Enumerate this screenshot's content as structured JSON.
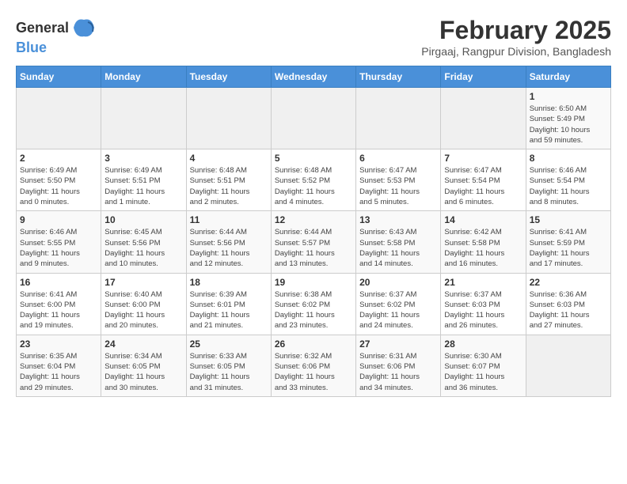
{
  "header": {
    "logo_general": "General",
    "logo_blue": "Blue",
    "title": "February 2025",
    "subtitle": "Pirgaaj, Rangpur Division, Bangladesh"
  },
  "weekdays": [
    "Sunday",
    "Monday",
    "Tuesday",
    "Wednesday",
    "Thursday",
    "Friday",
    "Saturday"
  ],
  "weeks": [
    [
      {
        "day": "",
        "info": ""
      },
      {
        "day": "",
        "info": ""
      },
      {
        "day": "",
        "info": ""
      },
      {
        "day": "",
        "info": ""
      },
      {
        "day": "",
        "info": ""
      },
      {
        "day": "",
        "info": ""
      },
      {
        "day": "1",
        "info": "Sunrise: 6:50 AM\nSunset: 5:49 PM\nDaylight: 10 hours\nand 59 minutes."
      }
    ],
    [
      {
        "day": "2",
        "info": "Sunrise: 6:49 AM\nSunset: 5:50 PM\nDaylight: 11 hours\nand 0 minutes."
      },
      {
        "day": "3",
        "info": "Sunrise: 6:49 AM\nSunset: 5:51 PM\nDaylight: 11 hours\nand 1 minute."
      },
      {
        "day": "4",
        "info": "Sunrise: 6:48 AM\nSunset: 5:51 PM\nDaylight: 11 hours\nand 2 minutes."
      },
      {
        "day": "5",
        "info": "Sunrise: 6:48 AM\nSunset: 5:52 PM\nDaylight: 11 hours\nand 4 minutes."
      },
      {
        "day": "6",
        "info": "Sunrise: 6:47 AM\nSunset: 5:53 PM\nDaylight: 11 hours\nand 5 minutes."
      },
      {
        "day": "7",
        "info": "Sunrise: 6:47 AM\nSunset: 5:54 PM\nDaylight: 11 hours\nand 6 minutes."
      },
      {
        "day": "8",
        "info": "Sunrise: 6:46 AM\nSunset: 5:54 PM\nDaylight: 11 hours\nand 8 minutes."
      }
    ],
    [
      {
        "day": "9",
        "info": "Sunrise: 6:46 AM\nSunset: 5:55 PM\nDaylight: 11 hours\nand 9 minutes."
      },
      {
        "day": "10",
        "info": "Sunrise: 6:45 AM\nSunset: 5:56 PM\nDaylight: 11 hours\nand 10 minutes."
      },
      {
        "day": "11",
        "info": "Sunrise: 6:44 AM\nSunset: 5:56 PM\nDaylight: 11 hours\nand 12 minutes."
      },
      {
        "day": "12",
        "info": "Sunrise: 6:44 AM\nSunset: 5:57 PM\nDaylight: 11 hours\nand 13 minutes."
      },
      {
        "day": "13",
        "info": "Sunrise: 6:43 AM\nSunset: 5:58 PM\nDaylight: 11 hours\nand 14 minutes."
      },
      {
        "day": "14",
        "info": "Sunrise: 6:42 AM\nSunset: 5:58 PM\nDaylight: 11 hours\nand 16 minutes."
      },
      {
        "day": "15",
        "info": "Sunrise: 6:41 AM\nSunset: 5:59 PM\nDaylight: 11 hours\nand 17 minutes."
      }
    ],
    [
      {
        "day": "16",
        "info": "Sunrise: 6:41 AM\nSunset: 6:00 PM\nDaylight: 11 hours\nand 19 minutes."
      },
      {
        "day": "17",
        "info": "Sunrise: 6:40 AM\nSunset: 6:00 PM\nDaylight: 11 hours\nand 20 minutes."
      },
      {
        "day": "18",
        "info": "Sunrise: 6:39 AM\nSunset: 6:01 PM\nDaylight: 11 hours\nand 21 minutes."
      },
      {
        "day": "19",
        "info": "Sunrise: 6:38 AM\nSunset: 6:02 PM\nDaylight: 11 hours\nand 23 minutes."
      },
      {
        "day": "20",
        "info": "Sunrise: 6:37 AM\nSunset: 6:02 PM\nDaylight: 11 hours\nand 24 minutes."
      },
      {
        "day": "21",
        "info": "Sunrise: 6:37 AM\nSunset: 6:03 PM\nDaylight: 11 hours\nand 26 minutes."
      },
      {
        "day": "22",
        "info": "Sunrise: 6:36 AM\nSunset: 6:03 PM\nDaylight: 11 hours\nand 27 minutes."
      }
    ],
    [
      {
        "day": "23",
        "info": "Sunrise: 6:35 AM\nSunset: 6:04 PM\nDaylight: 11 hours\nand 29 minutes."
      },
      {
        "day": "24",
        "info": "Sunrise: 6:34 AM\nSunset: 6:05 PM\nDaylight: 11 hours\nand 30 minutes."
      },
      {
        "day": "25",
        "info": "Sunrise: 6:33 AM\nSunset: 6:05 PM\nDaylight: 11 hours\nand 31 minutes."
      },
      {
        "day": "26",
        "info": "Sunrise: 6:32 AM\nSunset: 6:06 PM\nDaylight: 11 hours\nand 33 minutes."
      },
      {
        "day": "27",
        "info": "Sunrise: 6:31 AM\nSunset: 6:06 PM\nDaylight: 11 hours\nand 34 minutes."
      },
      {
        "day": "28",
        "info": "Sunrise: 6:30 AM\nSunset: 6:07 PM\nDaylight: 11 hours\nand 36 minutes."
      },
      {
        "day": "",
        "info": ""
      }
    ]
  ]
}
